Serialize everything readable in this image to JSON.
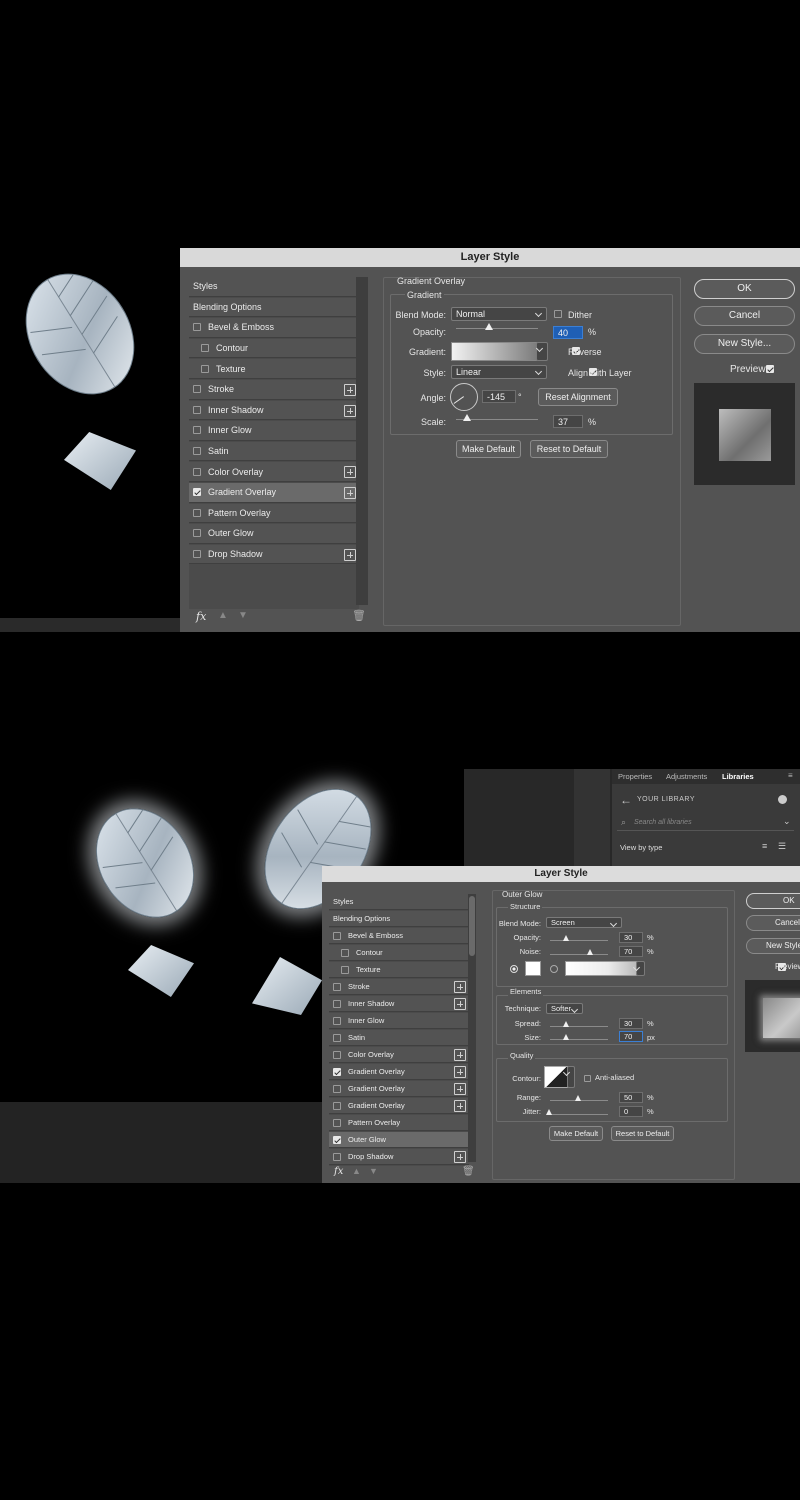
{
  "top_dialog": {
    "title": "Layer Style",
    "styles_list": [
      {
        "label": "Styles",
        "checkbox": false,
        "plus": false,
        "selected": false
      },
      {
        "label": "Blending Options",
        "checkbox": false,
        "plus": false,
        "selected": false
      },
      {
        "label": "Bevel & Emboss",
        "checkbox": true,
        "checked": false,
        "plus": false
      },
      {
        "label": "Contour",
        "checkbox": true,
        "checked": false,
        "plus": false,
        "indent": true
      },
      {
        "label": "Texture",
        "checkbox": true,
        "checked": false,
        "plus": false,
        "indent": true
      },
      {
        "label": "Stroke",
        "checkbox": true,
        "checked": false,
        "plus": true
      },
      {
        "label": "Inner Shadow",
        "checkbox": true,
        "checked": false,
        "plus": true
      },
      {
        "label": "Inner Glow",
        "checkbox": true,
        "checked": false,
        "plus": false
      },
      {
        "label": "Satin",
        "checkbox": true,
        "checked": false,
        "plus": false
      },
      {
        "label": "Color Overlay",
        "checkbox": true,
        "checked": false,
        "plus": true
      },
      {
        "label": "Gradient Overlay",
        "checkbox": true,
        "checked": true,
        "plus": true,
        "selected": true
      },
      {
        "label": "Pattern Overlay",
        "checkbox": true,
        "checked": false,
        "plus": false
      },
      {
        "label": "Outer Glow",
        "checkbox": true,
        "checked": false,
        "plus": false
      },
      {
        "label": "Drop Shadow",
        "checkbox": true,
        "checked": false,
        "plus": true
      }
    ],
    "fx_label": "fx",
    "section_title": "Gradient Overlay",
    "group_title": "Gradient",
    "blend_mode_label": "Blend Mode:",
    "blend_mode_value": "Normal",
    "dither_label": "Dither",
    "dither_checked": false,
    "opacity_label": "Opacity:",
    "opacity_value": "40",
    "opacity_fraction": 0.4,
    "percent": "%",
    "gradient_label": "Gradient:",
    "reverse_label": "Reverse",
    "reverse_checked": true,
    "style_label": "Style:",
    "style_value": "Linear",
    "align_label": "Align with Layer",
    "align_checked": true,
    "angle_label": "Angle:",
    "angle_value": "-145",
    "degree": "°",
    "reset_alignment": "Reset Alignment",
    "scale_label": "Scale:",
    "scale_value": "37",
    "scale_fraction": 0.14,
    "make_default": "Make Default",
    "reset_default": "Reset to Default",
    "ok": "OK",
    "cancel": "Cancel",
    "new_style": "New Style...",
    "preview_label": "Preview",
    "preview_checked": true
  },
  "libraries_panel": {
    "tabs": [
      "Properties",
      "Adjustments",
      "Libraries"
    ],
    "active_tab": "Libraries",
    "back_label": "YOUR LIBRARY",
    "search_placeholder": "Search all libraries",
    "view_by": "View by type"
  },
  "bottom_dialog": {
    "title": "Layer Style",
    "styles_list": [
      {
        "label": "Styles",
        "checkbox": false,
        "plus": false
      },
      {
        "label": "Blending Options",
        "checkbox": false,
        "plus": false
      },
      {
        "label": "Bevel & Emboss",
        "checkbox": true,
        "checked": false,
        "plus": false
      },
      {
        "label": "Contour",
        "checkbox": true,
        "checked": false,
        "plus": false,
        "indent": true
      },
      {
        "label": "Texture",
        "checkbox": true,
        "checked": false,
        "plus": false,
        "indent": true
      },
      {
        "label": "Stroke",
        "checkbox": true,
        "checked": false,
        "plus": true
      },
      {
        "label": "Inner Shadow",
        "checkbox": true,
        "checked": false,
        "plus": true
      },
      {
        "label": "Inner Glow",
        "checkbox": true,
        "checked": false,
        "plus": false
      },
      {
        "label": "Satin",
        "checkbox": true,
        "checked": false,
        "plus": false
      },
      {
        "label": "Color Overlay",
        "checkbox": true,
        "checked": false,
        "plus": true
      },
      {
        "label": "Gradient Overlay",
        "checkbox": true,
        "checked": true,
        "plus": true
      },
      {
        "label": "Gradient Overlay",
        "checkbox": true,
        "checked": false,
        "plus": true
      },
      {
        "label": "Gradient Overlay",
        "checkbox": true,
        "checked": false,
        "plus": true
      },
      {
        "label": "Pattern Overlay",
        "checkbox": true,
        "checked": false,
        "plus": false
      },
      {
        "label": "Outer Glow",
        "checkbox": true,
        "checked": true,
        "plus": false,
        "selected": true
      },
      {
        "label": "Drop Shadow",
        "checkbox": true,
        "checked": false,
        "plus": true
      }
    ],
    "fx_label": "fx",
    "section_title": "Outer Glow",
    "structure_title": "Structure",
    "blend_mode_label": "Blend Mode:",
    "blend_mode_value": "Screen",
    "opacity_label": "Opacity:",
    "opacity_value": "30",
    "opacity_fraction": 0.3,
    "noise_label": "Noise:",
    "noise_value": "70",
    "noise_fraction": 0.7,
    "percent": "%",
    "elements_title": "Elements",
    "technique_label": "Technique:",
    "technique_value": "Softer",
    "spread_label": "Spread:",
    "spread_value": "30",
    "spread_fraction": 0.3,
    "size_label": "Size:",
    "size_value": "70",
    "size_unit": "px",
    "size_fraction": 0.3,
    "quality_title": "Quality",
    "contour_label": "Contour:",
    "anti_aliased_label": "Anti-aliased",
    "anti_aliased_checked": false,
    "range_label": "Range:",
    "range_value": "50",
    "range_fraction": 0.5,
    "jitter_label": "Jitter:",
    "jitter_value": "0",
    "jitter_fraction": 0,
    "make_default": "Make Default",
    "reset_default": "Reset to Default",
    "ok": "OK",
    "cancel": "Cancel",
    "new_style": "New Style",
    "preview_label": "Preview",
    "preview_checked": true
  }
}
